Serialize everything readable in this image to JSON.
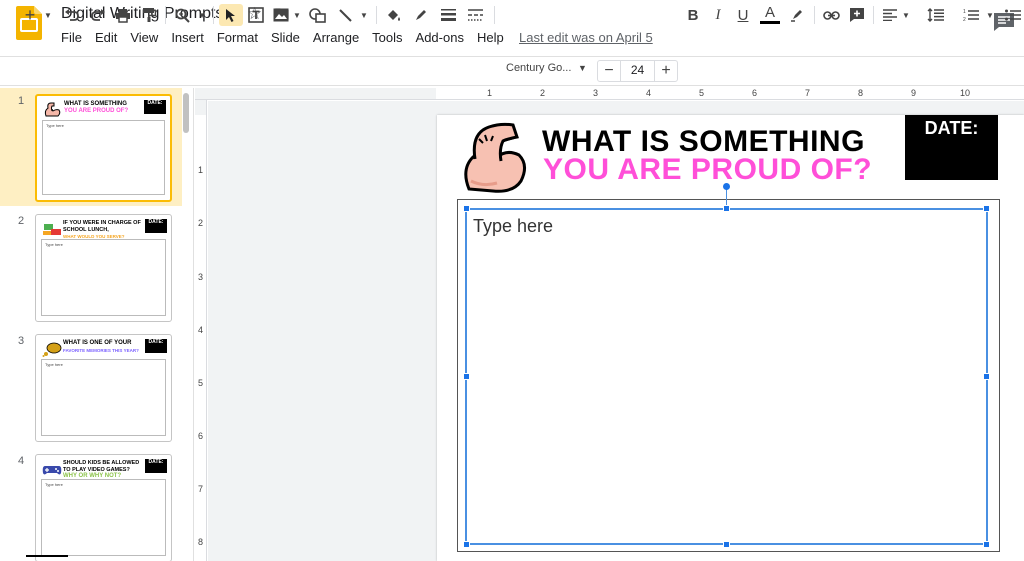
{
  "app": {
    "title": "Digital Writing Prompts",
    "last_edit": "Last edit was on April 5"
  },
  "menu": [
    "File",
    "Edit",
    "View",
    "Insert",
    "Format",
    "Slide",
    "Arrange",
    "Tools",
    "Add-ons",
    "Help"
  ],
  "toolbar": {
    "new_slide": "+",
    "font_name": "Century Go...",
    "font_size_minus": "−",
    "font_size": "24",
    "font_size_plus": "+",
    "bold": "B",
    "italic": "I",
    "underline": "U",
    "text_color": "A",
    "accent": "#fbbc04"
  },
  "filmstrip": {
    "slides": [
      {
        "num": "1",
        "title1": "WHAT IS SOMETHING",
        "title2": "YOU ARE PROUD OF?",
        "title2_color": "#ff4fd8",
        "date": "DATE:",
        "placeholder": "Type here",
        "icon": "flexed-arm-icon"
      },
      {
        "num": "2",
        "title1": "IF YOU WERE IN CHARGE OF SCHOOL LUNCH,",
        "title2": "WHAT WOULD YOU SERVE?",
        "title2_color": "#f5a623",
        "date": "DATE:",
        "placeholder": "Type here",
        "icon": "lunch-icon"
      },
      {
        "num": "3",
        "title1": "WHAT IS ONE OF YOUR",
        "title2": "FAVORITE MEMORIES THIS YEAR?",
        "title2_color": "#7b61ff",
        "date": "DATE:",
        "placeholder": "Type here",
        "icon": "thought-bubble-icon"
      },
      {
        "num": "4",
        "title1": "SHOULD KIDS BE ALLOWED TO PLAY VIDEO GAMES?",
        "title2": "WHY OR WHY NOT?",
        "title2_color": "#8bc34a",
        "date": "DATE:",
        "placeholder": "Type here",
        "icon": "game-controller-icon"
      }
    ]
  },
  "ruler": {
    "horizontal": [
      "1",
      "2",
      "3",
      "4",
      "5",
      "6",
      "7",
      "8",
      "9",
      "10"
    ],
    "vertical": [
      "1",
      "2",
      "3",
      "4",
      "5",
      "6",
      "7",
      "8"
    ]
  },
  "slide": {
    "line1": "WHAT IS SOMETHING",
    "line2": "YOU ARE PROUD OF?",
    "line2_color": "#ff4fd8",
    "date_label": "DATE:",
    "textbox_text": "Type here"
  }
}
